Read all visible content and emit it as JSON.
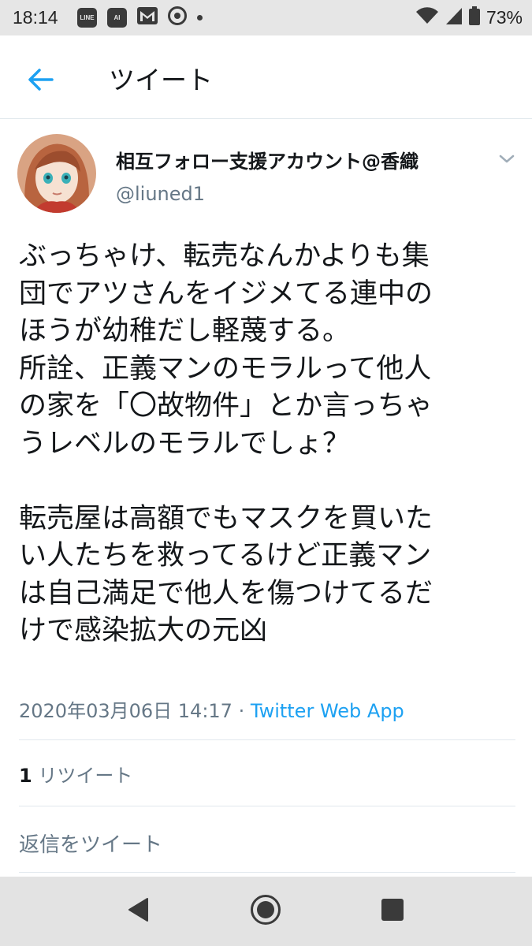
{
  "status_bar": {
    "time": "18:14",
    "notification_icons": [
      "line-icon",
      "ai-icon",
      "gmail-icon",
      "chrome-icon",
      "more-dot-icon"
    ],
    "battery_percent": "73%"
  },
  "header": {
    "title": "ツイート"
  },
  "tweet": {
    "display_name": "相互フォロー支援アカウント@香織",
    "handle": "@liuned1",
    "text": "ぶっちゃけ、転売なんかよりも集\n団でアツさんをイジメてる連中の\nほうが幼稚だし軽蔑する。\n所詮、正義マンのモラルって他人\nの家を「〇故物件」とか言っちゃ\nうレベルのモラルでしょ？\n\n転売屋は高額でもマスクを買いた\nい人たちを救ってるけど正義マン\nは自己満足で他人を傷つけてるだ\nけで感染拡大の元凶",
    "timestamp": "2020年03月06日 14:17",
    "separator": "·",
    "source": "Twitter Web App",
    "retweet_count": "1",
    "retweet_label": "リツイート"
  },
  "reply": {
    "placeholder": "返信をツイート"
  },
  "colors": {
    "accent": "#1da1f2",
    "secondary_text": "#657786",
    "primary_text": "#14171a",
    "status_bar_bg": "#e6e6e6",
    "nav_bar_bg": "#e3e3e3"
  }
}
